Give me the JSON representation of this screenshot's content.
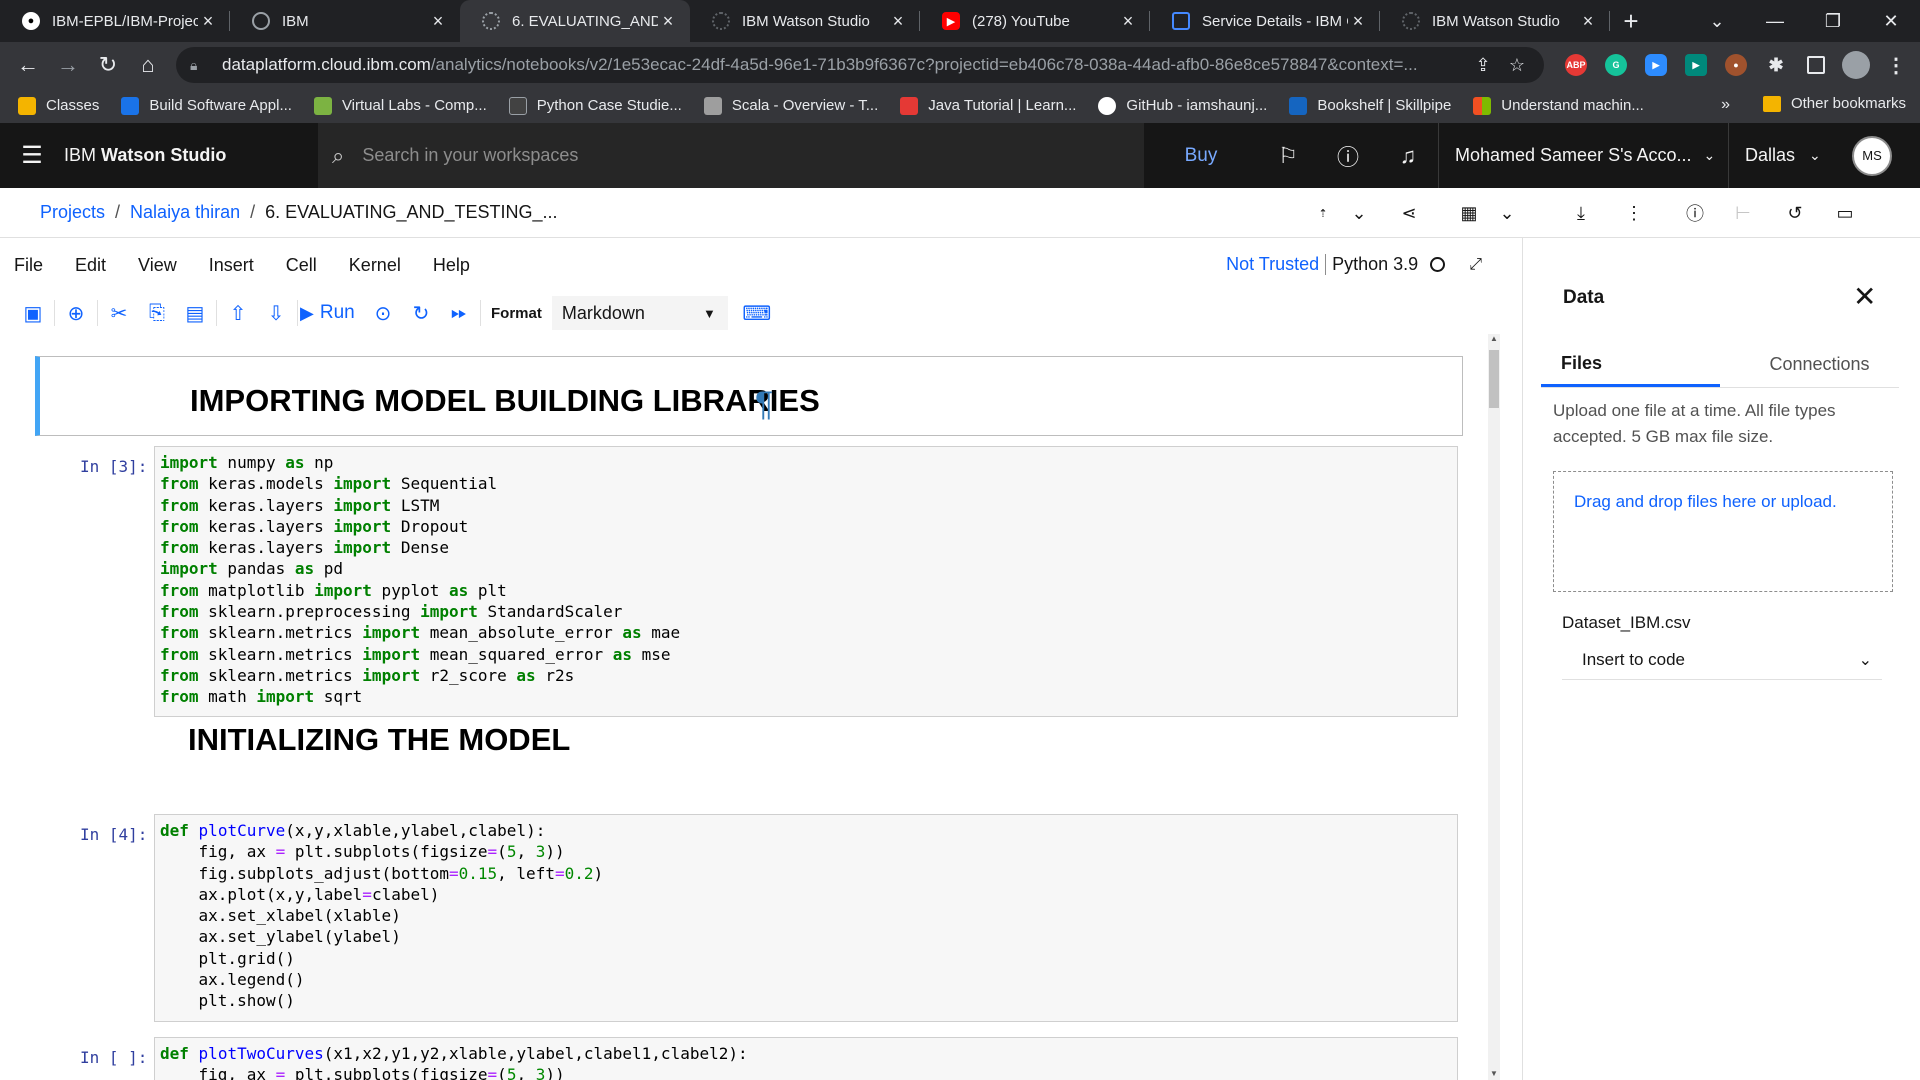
{
  "browser": {
    "tabs": [
      {
        "title": "IBM-EPBL/IBM-Projec",
        "icon": "github-icon",
        "color": "#ffffff"
      },
      {
        "title": "IBM",
        "icon": "globe-icon",
        "color": "#9aa0a6"
      },
      {
        "title": "6. EVALUATING_AND_",
        "icon": "spinner-icon",
        "color": "#9aa0a6"
      },
      {
        "title": "IBM Watson Studio",
        "icon": "watson-icon",
        "color": "#5f6368"
      },
      {
        "title": "(278) YouTube",
        "icon": "youtube-icon",
        "color": "#ff0000"
      },
      {
        "title": "Service Details - IBM C",
        "icon": "ibm-cloud-icon",
        "color": "#0f62fe"
      },
      {
        "title": "IBM Watson Studio",
        "icon": "watson-icon",
        "color": "#5f6368"
      }
    ],
    "url_host": "dataplatform.cloud.ibm.com",
    "url_path": "/analytics/notebooks/v2/1e53ecac-24df-4a5d-96e1-71b3b9f6367c?projectid=eb406c78-038a-44ad-afb0-86e8ce578847&context=...",
    "bookmarks": [
      {
        "label": "Classes",
        "color": "#f4b400"
      },
      {
        "label": "Build Software Appl...",
        "color": "#1a73e8"
      },
      {
        "label": "Virtual Labs - Comp...",
        "color": "#7cb342"
      },
      {
        "label": "Python Case Studie...",
        "color": "#424242"
      },
      {
        "label": "Scala - Overview - T...",
        "color": "#9e9e9e"
      },
      {
        "label": "Java Tutorial | Learn...",
        "color": "#e53935"
      },
      {
        "label": "GitHub - iamshaunj...",
        "color": "#ffffff"
      },
      {
        "label": "Bookshelf | Skillpipe",
        "color": "#1565c0"
      },
      {
        "label": "Understand machin...",
        "color": "#f25022"
      }
    ],
    "bookmarks_more": "»",
    "other_bookmarks": "Other bookmarks"
  },
  "header": {
    "brand_prefix": "IBM",
    "brand_name": "Watson Studio",
    "search_placeholder": "Search in your workspaces",
    "buy": "Buy",
    "account": "Mohamed Sameer S's Acco...",
    "region": "Dallas",
    "avatar": "MS"
  },
  "breadcrumb": {
    "projects": "Projects",
    "project": "Nalaiya thiran",
    "notebook": "6. EVALUATING_AND_TESTING_..."
  },
  "menu": [
    "File",
    "Edit",
    "View",
    "Insert",
    "Cell",
    "Kernel",
    "Help"
  ],
  "kernel": {
    "trust": "Not Trusted",
    "name": "Python 3.9"
  },
  "toolbar": {
    "run": "Run",
    "format_label": "Format",
    "format_value": "Markdown"
  },
  "notebook": {
    "heading1": "IMPORTING MODEL BUILDING LIBRARIES",
    "pilcrow": "¶",
    "heading2": "INITIALIZING THE MODEL",
    "prompt1": "In [3]:",
    "prompt2": "In [4]:",
    "prompt3": "In [ ]:"
  },
  "data_panel": {
    "title": "Data",
    "tab_files": "Files",
    "tab_connections": "Connections",
    "description": "Upload one file at a time. All file types accepted. 5 GB max file size.",
    "dropzone": "Drag and drop files here or upload.",
    "file_name": "Dataset_IBM.csv",
    "insert_to_code": "Insert to code"
  }
}
